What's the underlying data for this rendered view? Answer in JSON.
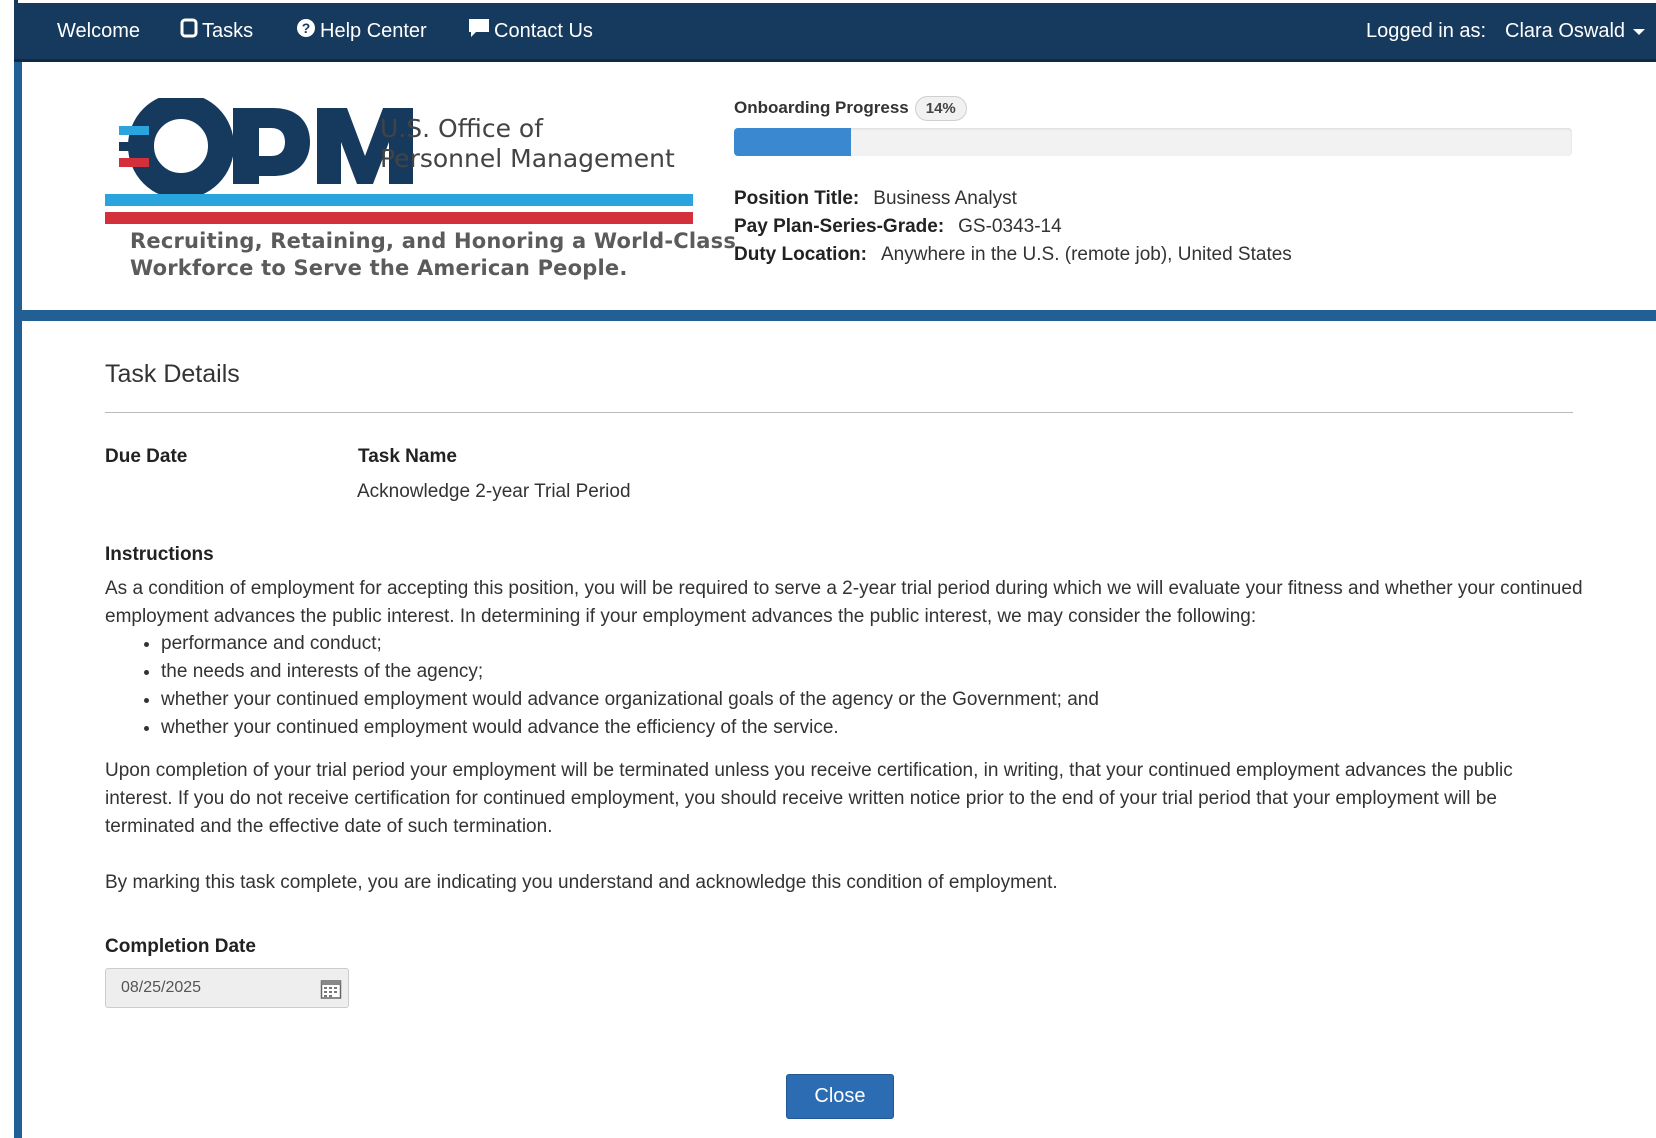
{
  "nav": {
    "welcome": "Welcome",
    "tasks": "Tasks",
    "help": "Help Center",
    "contact": "Contact Us",
    "logged_in_label": "Logged in as:",
    "user_name": "Clara Oswald"
  },
  "header": {
    "logo_name_line1": "U.S. Office of",
    "logo_name_line2": "Personnel Management",
    "logo_tagline_line1": "Recruiting, Retaining, and Honoring a World-Class",
    "logo_tagline_line2": "Workforce to Serve the American People.",
    "progress_label": "Onboarding Progress",
    "progress_text": "14%",
    "progress_value": 14,
    "position_title_label": "Position Title:",
    "position_title": "Business Analyst",
    "pay_plan_label": "Pay Plan-Series-Grade:",
    "pay_plan": "GS-0343-14",
    "duty_location_label": "Duty Location:",
    "duty_location": "Anywhere in the U.S. (remote job), United States"
  },
  "task": {
    "section_title": "Task Details",
    "due_date_label": "Due Date",
    "task_name_label": "Task Name",
    "task_name": "Acknowledge 2-year Trial Period",
    "instructions_label": "Instructions",
    "paragraph1": "As a condition of employment for accepting this position, you will be required to serve a 2-year trial period during which we will evaluate your fitness and whether your continued employment advances the public interest. In determining if your employment advances the public interest, we may consider the following:",
    "bullets": [
      "performance and conduct;",
      "the needs and interests of the agency;",
      "whether your continued employment would advance organizational goals of the agency or the Government; and",
      "whether your continued employment would advance the efficiency of the service."
    ],
    "paragraph2": "Upon completion of your trial period your employment will be terminated unless you receive certification, in writing, that your continued employment advances the public interest. If you do not receive certification for continued employment, you should receive written notice prior to the end of your trial period that your employment will be terminated and the effective date of such termination.",
    "paragraph3": "By marking this task complete, you are indicating you understand and acknowledge this condition of employment.",
    "completion_date_label": "Completion Date",
    "completion_date": "08/25/2025",
    "close_label": "Close"
  },
  "colors": {
    "navbar": "#163a5e",
    "frame": "#215f94",
    "progress_fill": "#3a88cf",
    "logo_navy": "#163a5e",
    "logo_blue": "#2aa4dc",
    "logo_red": "#d3303b"
  }
}
